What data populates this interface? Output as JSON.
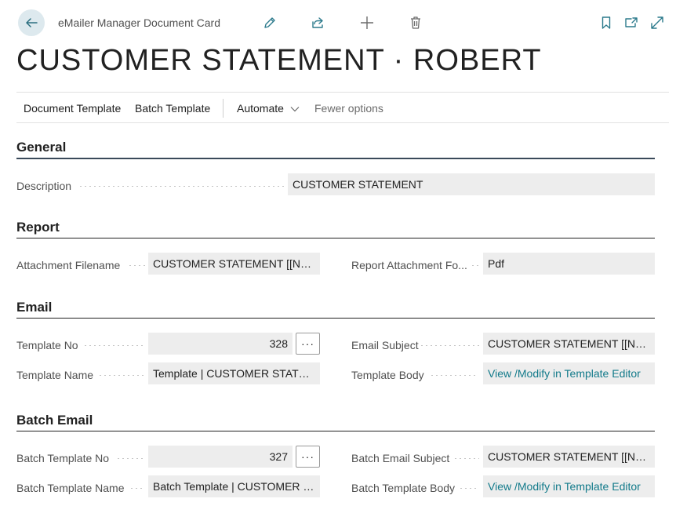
{
  "header": {
    "card_label": "eMailer Manager Document Card",
    "title": "CUSTOMER STATEMENT · ROBERT",
    "icons": [
      "back-arrow-icon",
      "edit-icon",
      "share-icon",
      "add-icon",
      "delete-icon",
      "bookmark-icon",
      "open-new-window-icon",
      "expand-icon"
    ]
  },
  "actions": {
    "document_template": "Document Template",
    "batch_template": "Batch Template",
    "automate": "Automate",
    "fewer_options": "Fewer options"
  },
  "general": {
    "title": "General",
    "description_label": "Description",
    "description_value": "CUSTOMER STATEMENT"
  },
  "report": {
    "title": "Report",
    "attachment_filename_label": "Attachment Filename",
    "attachment_filename_value": "CUSTOMER STATEMENT [[No.]]",
    "attachment_format_label": "Report Attachment Fo...",
    "attachment_format_value": "Pdf"
  },
  "email": {
    "title": "Email",
    "template_no_label": "Template No",
    "template_no_value": "328",
    "email_subject_label": "Email Subject",
    "email_subject_value": "CUSTOMER STATEMENT [[No.]]",
    "template_name_label": "Template Name",
    "template_name_value": "Template | CUSTOMER STATEME...",
    "template_body_label": "Template Body",
    "template_body_value": "View /Modify in Template Editor",
    "lookup_label": "···"
  },
  "batch_email": {
    "title": "Batch Email",
    "batch_template_no_label": "Batch Template No",
    "batch_template_no_value": "327",
    "batch_email_subject_label": "Batch Email Subject",
    "batch_email_subject_value": "CUSTOMER STATEMENT [[No.]]",
    "batch_template_name_label": "Batch Template Name",
    "batch_template_name_value": "Batch Template | CUSTOMER ST...",
    "batch_template_body_label": "Batch Template Body",
    "batch_template_body_value": "View /Modify in Template Editor",
    "lookup_label": "···"
  },
  "colors": {
    "accent": "#127a8a",
    "icon": "#2c7a8c",
    "field_bg": "#ededed"
  }
}
